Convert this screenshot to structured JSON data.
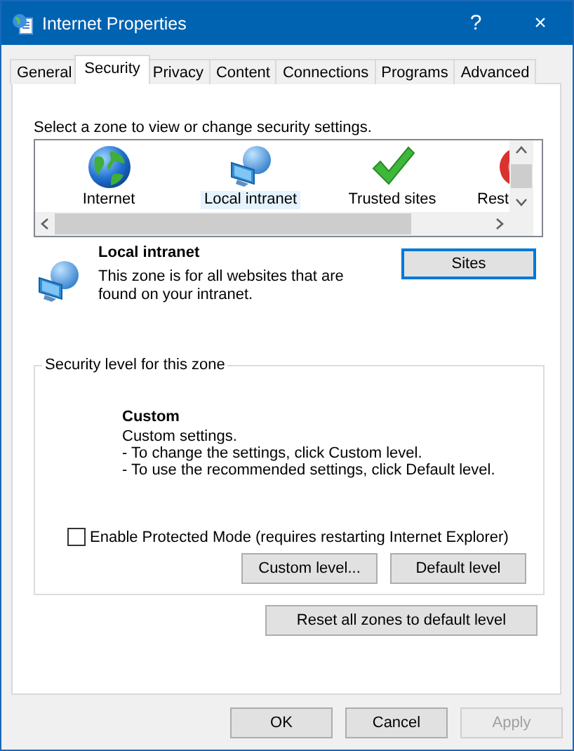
{
  "window": {
    "title": "Internet Properties",
    "help": "?",
    "close": "×"
  },
  "tabs": [
    {
      "label": "General",
      "selected": false
    },
    {
      "label": "Security",
      "selected": true
    },
    {
      "label": "Privacy",
      "selected": false
    },
    {
      "label": "Content",
      "selected": false
    },
    {
      "label": "Connections",
      "selected": false
    },
    {
      "label": "Programs",
      "selected": false
    },
    {
      "label": "Advanced",
      "selected": false
    }
  ],
  "zone_prompt": "Select a zone to view or change security settings.",
  "zones": [
    {
      "label": "Internet",
      "kind": "globe",
      "selected": false
    },
    {
      "label": "Local intranet",
      "kind": "intranet",
      "selected": true
    },
    {
      "label": "Trusted sites",
      "kind": "check",
      "selected": false
    },
    {
      "label": "Rest",
      "kind": "restricted",
      "selected": false
    }
  ],
  "zone_info": {
    "kind": "intranet",
    "title": "Local intranet",
    "description": "This zone is for all websites that are found on your intranet.",
    "button": "Sites"
  },
  "security_level": {
    "group_title": "Security level for this zone",
    "level_title": "Custom",
    "lines": [
      "Custom settings.",
      "- To change the settings, click Custom level.",
      "- To use the recommended settings, click Default level."
    ],
    "protected_mode": {
      "label": "Enable Protected Mode (requires restarting Internet Explorer)",
      "checked": false
    },
    "buttons": [
      "Custom level...",
      "Default level"
    ]
  },
  "reset_button": "Reset all zones to default level",
  "footer_buttons": [
    {
      "label": "OK",
      "disabled": false
    },
    {
      "label": "Cancel",
      "disabled": false
    },
    {
      "label": "Apply",
      "disabled": true
    }
  ]
}
